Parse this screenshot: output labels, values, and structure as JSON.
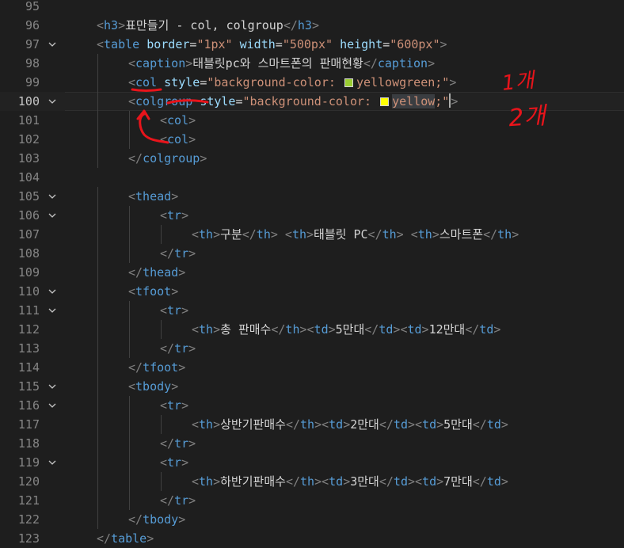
{
  "editor": {
    "lines": [
      {
        "num": "95",
        "indent": 0,
        "fold": false,
        "current": false,
        "segs": []
      },
      {
        "num": "96",
        "indent": 1,
        "fold": false,
        "current": false,
        "segs": [
          {
            "c": "br",
            "t": "<"
          },
          {
            "c": "tag",
            "t": "h3"
          },
          {
            "c": "br",
            "t": ">"
          },
          {
            "c": "txt",
            "t": "표만들기 - col, colgroup"
          },
          {
            "c": "br",
            "t": "</"
          },
          {
            "c": "tag",
            "t": "h3"
          },
          {
            "c": "br",
            "t": ">"
          }
        ]
      },
      {
        "num": "97",
        "indent": 1,
        "fold": true,
        "current": false,
        "segs": [
          {
            "c": "br",
            "t": "<"
          },
          {
            "c": "tag",
            "t": "table"
          },
          {
            "c": "txt",
            "t": " "
          },
          {
            "c": "attr",
            "t": "border"
          },
          {
            "c": "eq",
            "t": "="
          },
          {
            "c": "str",
            "t": "\"1px\""
          },
          {
            "c": "txt",
            "t": " "
          },
          {
            "c": "attr",
            "t": "width"
          },
          {
            "c": "eq",
            "t": "="
          },
          {
            "c": "str",
            "t": "\"500px\""
          },
          {
            "c": "txt",
            "t": " "
          },
          {
            "c": "attr",
            "t": "height"
          },
          {
            "c": "eq",
            "t": "="
          },
          {
            "c": "str",
            "t": "\"600px\""
          },
          {
            "c": "br",
            "t": ">"
          }
        ]
      },
      {
        "num": "98",
        "indent": 2,
        "fold": false,
        "current": false,
        "segs": [
          {
            "c": "br",
            "t": "<"
          },
          {
            "c": "tag",
            "t": "caption"
          },
          {
            "c": "br",
            "t": ">"
          },
          {
            "c": "txt",
            "t": "태블릿pc와 스마트폰의 판매현황"
          },
          {
            "c": "br",
            "t": "</"
          },
          {
            "c": "tag",
            "t": "caption"
          },
          {
            "c": "br",
            "t": ">"
          }
        ]
      },
      {
        "num": "99",
        "indent": 2,
        "fold": false,
        "current": false,
        "segs": [
          {
            "c": "br",
            "t": "<"
          },
          {
            "c": "tag",
            "t": "col"
          },
          {
            "c": "txt",
            "t": " "
          },
          {
            "c": "attr",
            "t": "style"
          },
          {
            "c": "eq",
            "t": "="
          },
          {
            "c": "str",
            "t": "\"background-color: "
          },
          {
            "c": "swatch",
            "color": "#9acd32"
          },
          {
            "c": "str",
            "t": "yellowgreen;\""
          },
          {
            "c": "br",
            "t": ">"
          }
        ]
      },
      {
        "num": "100",
        "indent": 2,
        "fold": true,
        "current": true,
        "segs": [
          {
            "c": "br",
            "t": "<"
          },
          {
            "c": "tag",
            "t": "colgroup"
          },
          {
            "c": "txt",
            "t": " "
          },
          {
            "c": "attr",
            "t": "style"
          },
          {
            "c": "eq",
            "t": "="
          },
          {
            "c": "str",
            "t": "\"background-color: "
          },
          {
            "c": "swatch",
            "color": "#ffff00"
          },
          {
            "c": "str hl",
            "t": "yellow"
          },
          {
            "c": "str",
            "t": ";\""
          },
          {
            "c": "caret"
          },
          {
            "c": "br",
            "t": ">"
          }
        ]
      },
      {
        "num": "101",
        "indent": 3,
        "fold": false,
        "current": false,
        "segs": [
          {
            "c": "br",
            "t": "<"
          },
          {
            "c": "tag",
            "t": "col"
          },
          {
            "c": "br",
            "t": ">"
          }
        ]
      },
      {
        "num": "102",
        "indent": 3,
        "fold": false,
        "current": false,
        "segs": [
          {
            "c": "br",
            "t": "<"
          },
          {
            "c": "tag",
            "t": "col"
          },
          {
            "c": "br",
            "t": ">"
          }
        ]
      },
      {
        "num": "103",
        "indent": 2,
        "fold": false,
        "current": false,
        "segs": [
          {
            "c": "br",
            "t": "</"
          },
          {
            "c": "tag",
            "t": "colgroup"
          },
          {
            "c": "br",
            "t": ">"
          }
        ]
      },
      {
        "num": "104",
        "indent": 0,
        "fold": false,
        "current": false,
        "segs": []
      },
      {
        "num": "105",
        "indent": 2,
        "fold": true,
        "current": false,
        "segs": [
          {
            "c": "br",
            "t": "<"
          },
          {
            "c": "tag",
            "t": "thead"
          },
          {
            "c": "br",
            "t": ">"
          }
        ]
      },
      {
        "num": "106",
        "indent": 3,
        "fold": true,
        "current": false,
        "segs": [
          {
            "c": "br",
            "t": "<"
          },
          {
            "c": "tag",
            "t": "tr"
          },
          {
            "c": "br",
            "t": ">"
          }
        ]
      },
      {
        "num": "107",
        "indent": 4,
        "fold": false,
        "current": false,
        "segs": [
          {
            "c": "br",
            "t": "<"
          },
          {
            "c": "tag",
            "t": "th"
          },
          {
            "c": "br",
            "t": ">"
          },
          {
            "c": "txt",
            "t": "구분"
          },
          {
            "c": "br",
            "t": "</"
          },
          {
            "c": "tag",
            "t": "th"
          },
          {
            "c": "br",
            "t": ">"
          },
          {
            "c": "txt",
            "t": " "
          },
          {
            "c": "br",
            "t": "<"
          },
          {
            "c": "tag",
            "t": "th"
          },
          {
            "c": "br",
            "t": ">"
          },
          {
            "c": "txt",
            "t": "태블릿 PC"
          },
          {
            "c": "br",
            "t": "</"
          },
          {
            "c": "tag",
            "t": "th"
          },
          {
            "c": "br",
            "t": ">"
          },
          {
            "c": "txt",
            "t": " "
          },
          {
            "c": "br",
            "t": "<"
          },
          {
            "c": "tag",
            "t": "th"
          },
          {
            "c": "br",
            "t": ">"
          },
          {
            "c": "txt",
            "t": "스마트폰"
          },
          {
            "c": "br",
            "t": "</"
          },
          {
            "c": "tag",
            "t": "th"
          },
          {
            "c": "br",
            "t": ">"
          }
        ]
      },
      {
        "num": "108",
        "indent": 3,
        "fold": false,
        "current": false,
        "segs": [
          {
            "c": "br",
            "t": "</"
          },
          {
            "c": "tag",
            "t": "tr"
          },
          {
            "c": "br",
            "t": ">"
          }
        ]
      },
      {
        "num": "109",
        "indent": 2,
        "fold": false,
        "current": false,
        "segs": [
          {
            "c": "br",
            "t": "</"
          },
          {
            "c": "tag",
            "t": "thead"
          },
          {
            "c": "br",
            "t": ">"
          }
        ]
      },
      {
        "num": "110",
        "indent": 2,
        "fold": true,
        "current": false,
        "segs": [
          {
            "c": "br",
            "t": "<"
          },
          {
            "c": "tag",
            "t": "tfoot"
          },
          {
            "c": "br",
            "t": ">"
          }
        ]
      },
      {
        "num": "111",
        "indent": 3,
        "fold": true,
        "current": false,
        "segs": [
          {
            "c": "br",
            "t": "<"
          },
          {
            "c": "tag",
            "t": "tr"
          },
          {
            "c": "br",
            "t": ">"
          }
        ]
      },
      {
        "num": "112",
        "indent": 4,
        "fold": false,
        "current": false,
        "segs": [
          {
            "c": "br",
            "t": "<"
          },
          {
            "c": "tag",
            "t": "th"
          },
          {
            "c": "br",
            "t": ">"
          },
          {
            "c": "txt",
            "t": "총 판매수"
          },
          {
            "c": "br",
            "t": "</"
          },
          {
            "c": "tag",
            "t": "th"
          },
          {
            "c": "br",
            "t": ">"
          },
          {
            "c": "br",
            "t": "<"
          },
          {
            "c": "tag",
            "t": "td"
          },
          {
            "c": "br",
            "t": ">"
          },
          {
            "c": "txt",
            "t": "5만대"
          },
          {
            "c": "br",
            "t": "</"
          },
          {
            "c": "tag",
            "t": "td"
          },
          {
            "c": "br",
            "t": ">"
          },
          {
            "c": "br",
            "t": "<"
          },
          {
            "c": "tag",
            "t": "td"
          },
          {
            "c": "br",
            "t": ">"
          },
          {
            "c": "txt",
            "t": "12만대"
          },
          {
            "c": "br",
            "t": "</"
          },
          {
            "c": "tag",
            "t": "td"
          },
          {
            "c": "br",
            "t": ">"
          }
        ]
      },
      {
        "num": "113",
        "indent": 3,
        "fold": false,
        "current": false,
        "segs": [
          {
            "c": "br",
            "t": "</"
          },
          {
            "c": "tag",
            "t": "tr"
          },
          {
            "c": "br",
            "t": ">"
          }
        ]
      },
      {
        "num": "114",
        "indent": 2,
        "fold": false,
        "current": false,
        "segs": [
          {
            "c": "br",
            "t": "</"
          },
          {
            "c": "tag",
            "t": "tfoot"
          },
          {
            "c": "br",
            "t": ">"
          }
        ]
      },
      {
        "num": "115",
        "indent": 2,
        "fold": true,
        "current": false,
        "segs": [
          {
            "c": "br",
            "t": "<"
          },
          {
            "c": "tag",
            "t": "tbody"
          },
          {
            "c": "br",
            "t": ">"
          }
        ]
      },
      {
        "num": "116",
        "indent": 3,
        "fold": true,
        "current": false,
        "segs": [
          {
            "c": "br",
            "t": "<"
          },
          {
            "c": "tag",
            "t": "tr"
          },
          {
            "c": "br",
            "t": ">"
          }
        ]
      },
      {
        "num": "117",
        "indent": 4,
        "fold": false,
        "current": false,
        "segs": [
          {
            "c": "br",
            "t": "<"
          },
          {
            "c": "tag",
            "t": "th"
          },
          {
            "c": "br",
            "t": ">"
          },
          {
            "c": "txt",
            "t": "상반기판매수"
          },
          {
            "c": "br",
            "t": "</"
          },
          {
            "c": "tag",
            "t": "th"
          },
          {
            "c": "br",
            "t": ">"
          },
          {
            "c": "br",
            "t": "<"
          },
          {
            "c": "tag",
            "t": "td"
          },
          {
            "c": "br",
            "t": ">"
          },
          {
            "c": "txt",
            "t": "2만대"
          },
          {
            "c": "br",
            "t": "</"
          },
          {
            "c": "tag",
            "t": "td"
          },
          {
            "c": "br",
            "t": ">"
          },
          {
            "c": "br",
            "t": "<"
          },
          {
            "c": "tag",
            "t": "td"
          },
          {
            "c": "br",
            "t": ">"
          },
          {
            "c": "txt",
            "t": "5만대"
          },
          {
            "c": "br",
            "t": "</"
          },
          {
            "c": "tag",
            "t": "td"
          },
          {
            "c": "br",
            "t": ">"
          }
        ]
      },
      {
        "num": "118",
        "indent": 3,
        "fold": false,
        "current": false,
        "segs": [
          {
            "c": "br",
            "t": "</"
          },
          {
            "c": "tag",
            "t": "tr"
          },
          {
            "c": "br",
            "t": ">"
          }
        ]
      },
      {
        "num": "119",
        "indent": 3,
        "fold": true,
        "current": false,
        "segs": [
          {
            "c": "br",
            "t": "<"
          },
          {
            "c": "tag",
            "t": "tr"
          },
          {
            "c": "br",
            "t": ">"
          }
        ]
      },
      {
        "num": "120",
        "indent": 4,
        "fold": false,
        "current": false,
        "segs": [
          {
            "c": "br",
            "t": "<"
          },
          {
            "c": "tag",
            "t": "th"
          },
          {
            "c": "br",
            "t": ">"
          },
          {
            "c": "txt",
            "t": "하반기판매수"
          },
          {
            "c": "br",
            "t": "</"
          },
          {
            "c": "tag",
            "t": "th"
          },
          {
            "c": "br",
            "t": ">"
          },
          {
            "c": "br",
            "t": "<"
          },
          {
            "c": "tag",
            "t": "td"
          },
          {
            "c": "br",
            "t": ">"
          },
          {
            "c": "txt",
            "t": "3만대"
          },
          {
            "c": "br",
            "t": "</"
          },
          {
            "c": "tag",
            "t": "td"
          },
          {
            "c": "br",
            "t": ">"
          },
          {
            "c": "br",
            "t": "<"
          },
          {
            "c": "tag",
            "t": "td"
          },
          {
            "c": "br",
            "t": ">"
          },
          {
            "c": "txt",
            "t": "7만대"
          },
          {
            "c": "br",
            "t": "</"
          },
          {
            "c": "tag",
            "t": "td"
          },
          {
            "c": "br",
            "t": ">"
          }
        ]
      },
      {
        "num": "121",
        "indent": 3,
        "fold": false,
        "current": false,
        "segs": [
          {
            "c": "br",
            "t": "</"
          },
          {
            "c": "tag",
            "t": "tr"
          },
          {
            "c": "br",
            "t": ">"
          }
        ]
      },
      {
        "num": "122",
        "indent": 2,
        "fold": false,
        "current": false,
        "segs": [
          {
            "c": "br",
            "t": "</"
          },
          {
            "c": "tag",
            "t": "tbody"
          },
          {
            "c": "br",
            "t": ">"
          }
        ]
      },
      {
        "num": "123",
        "indent": 1,
        "fold": false,
        "current": false,
        "segs": [
          {
            "c": "br",
            "t": "</"
          },
          {
            "c": "tag",
            "t": "table"
          },
          {
            "c": "br",
            "t": ">"
          }
        ]
      }
    ]
  },
  "annotations": {
    "note1": "1개",
    "note2": "2개",
    "color": "#e8141b"
  },
  "theme": {
    "background": "#1e1e1e",
    "tag": "#569cd6",
    "attribute": "#9cdcfe",
    "string": "#ce9178",
    "text": "#d4d4d4",
    "bracket": "#808080"
  }
}
